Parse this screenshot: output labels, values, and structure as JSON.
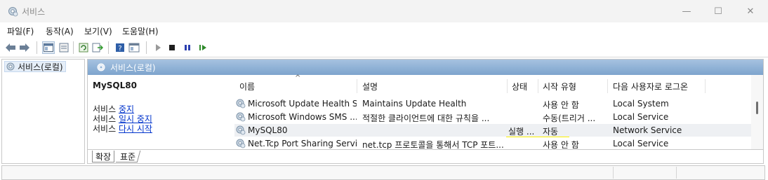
{
  "window": {
    "title": "서비스",
    "minimize_glyph": "—",
    "maximize_glyph": "☐",
    "close_glyph": "✕"
  },
  "menu": [
    "파일(F)",
    "동작(A)",
    "보기(V)",
    "도움말(H)"
  ],
  "toolbar_icons": [
    "back-arrow-icon",
    "forward-arrow-icon",
    "show-tree-icon",
    "properties-icon",
    "refresh-icon",
    "export-list-icon",
    "help-icon",
    "console-icon",
    "start-service-icon",
    "stop-service-icon",
    "pause-service-icon",
    "resume-service-icon"
  ],
  "tree": {
    "root_label": "서비스(로컬)"
  },
  "pane_header": {
    "label": "서비스(로컬)"
  },
  "details": {
    "service_name": "MySQL80",
    "action_prefix": "서비스",
    "actions": [
      "중지",
      "일시 중지",
      "다시 시작"
    ]
  },
  "columns": [
    "이름",
    "설명",
    "상태",
    "시작 유형",
    "다음 사용자로 로그온"
  ],
  "sort_indicator": "^",
  "services": [
    {
      "name": "Microsoft Update Health S...",
      "description": "Maintains Update Health",
      "status": "",
      "startup": "사용 안 함",
      "logon": "Local System"
    },
    {
      "name": "Microsoft Windows SMS ...",
      "description": "적절한 클라이언트에 대한 규칙을 ...",
      "status": "",
      "startup": "수동(트리거 ...",
      "logon": "Local Service"
    },
    {
      "name": "MySQL80",
      "description": "",
      "status": "실행 ...",
      "startup": "자동",
      "logon": "Network Service"
    },
    {
      "name": "Net.Tcp Port Sharing Service",
      "description": "net.tcp 프로토콜을 통해서 TCP 포트...",
      "status": "",
      "startup": "사용 안 함",
      "logon": "Local Service"
    }
  ],
  "tabs": [
    "확장",
    "표준"
  ],
  "colors": {
    "highlight": "#fff200",
    "link": "#0033cc",
    "header_blue": "#8fb2d8"
  }
}
